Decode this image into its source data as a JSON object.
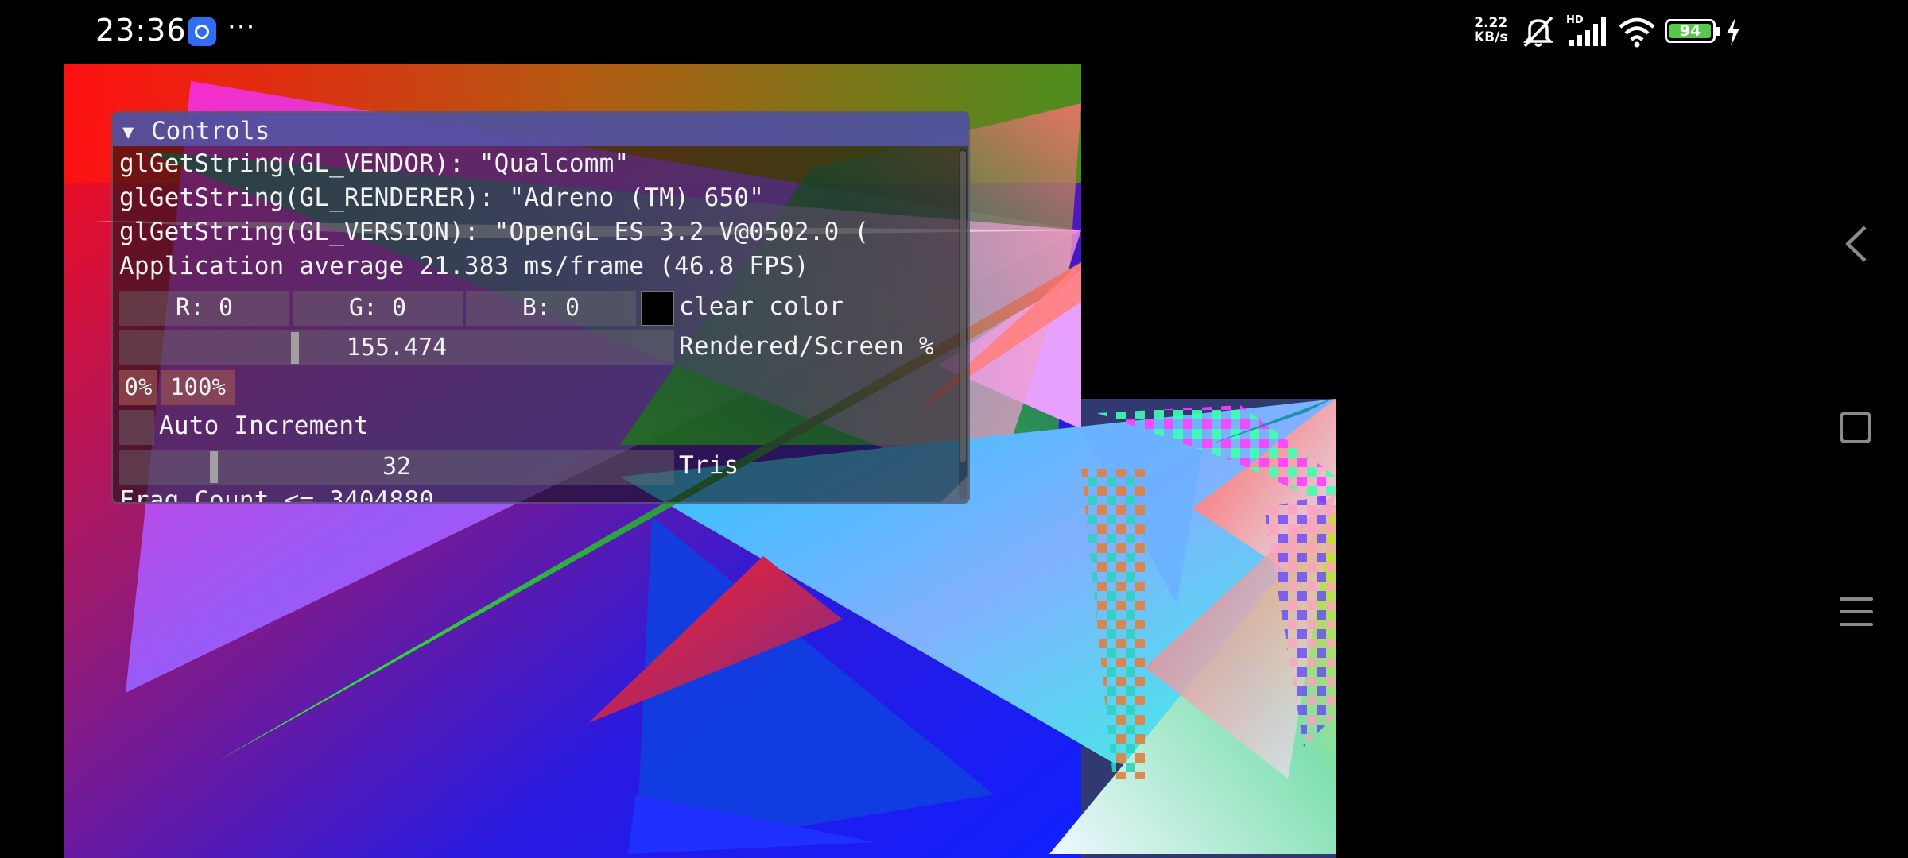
{
  "status_bar": {
    "time": "23:36",
    "app_icon": "blue-app-icon",
    "more": "···",
    "net_speed_value": "2.22",
    "net_speed_unit": "KB/s",
    "mute_icon": "bell-off-icon",
    "network_label": "HD",
    "signal_icon": "signal-icon",
    "wifi_icon": "wifi-icon",
    "battery": "94",
    "battery_color": "#56c94a",
    "charging_icon": "bolt-icon"
  },
  "nav": {
    "back_icon": "back-chevron-icon",
    "home_icon": "square-home-icon",
    "menu_icon": "menu-lines-icon"
  },
  "controls": {
    "title": "Controls",
    "collapse_arrow": "▼",
    "vendor": "glGetString(GL_VENDOR): \"Qualcomm\"",
    "renderer": "glGetString(GL_RENDERER): \"Adreno (TM) 650\"",
    "version": "glGetString(GL_VERSION): \"OpenGL ES 3.2 V@0502.0 (",
    "app_average": "Application average 21.383 ms/frame (46.8 FPS)",
    "clear_color": {
      "r": "R:  0",
      "g": "G:  0",
      "b": "B:  0",
      "label": "clear color",
      "swatch_color": "#000000"
    },
    "rendered_screen": {
      "value": "155.474",
      "label": "Rendered/Screen %"
    },
    "buttons": {
      "zero": "0%",
      "hundred": "100%"
    },
    "auto_increment": {
      "label": "Auto Increment",
      "checked": false
    },
    "tris": {
      "value": "32",
      "label": "Tris"
    },
    "frag_count": "Frag Count <= 3404880"
  },
  "colors": {
    "title_bar": "#5555aa",
    "button": "#964f4f",
    "battery": "#56c94a"
  }
}
